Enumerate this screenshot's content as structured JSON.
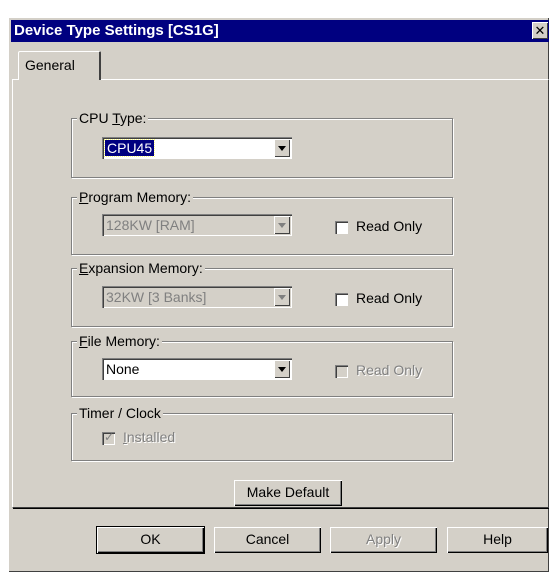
{
  "window": {
    "title": "Device Type Settings [CS1G]",
    "close_glyph": "✕"
  },
  "tabs": [
    {
      "label": "General",
      "active": true
    }
  ],
  "cpu_type": {
    "legend_pre": "CPU ",
    "legend_u": "T",
    "legend_post": "ype:",
    "value": "CPU45"
  },
  "program_memory": {
    "legend_u": "P",
    "legend_post": "rogram Memory:",
    "value": "128KW [RAM]",
    "read_only_label": "Read Only",
    "read_only_checked": false
  },
  "expansion_memory": {
    "legend_u": "E",
    "legend_post": "xpansion Memory:",
    "value": "32KW [3 Banks]",
    "read_only_label": "Read Only",
    "read_only_checked": false
  },
  "file_memory": {
    "legend_u": "F",
    "legend_post": "ile Memory:",
    "value": "None",
    "read_only_label": "Read Only",
    "read_only_checked": false
  },
  "timer_clock": {
    "legend": "Timer / Clock",
    "installed_label_u": "I",
    "installed_label_post": "nstalled",
    "installed_checked": true
  },
  "make_default_label": "Make Default",
  "buttons": {
    "ok": "OK",
    "cancel": "Cancel",
    "apply": "Apply",
    "help": "Help"
  }
}
